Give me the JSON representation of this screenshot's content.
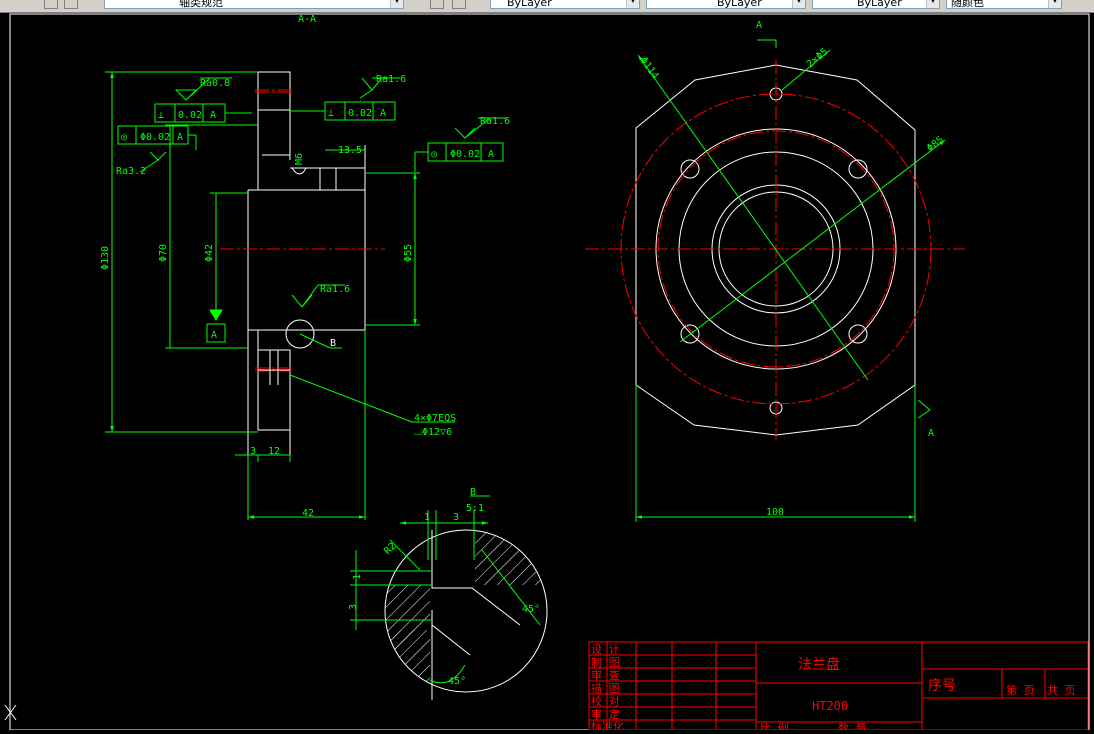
{
  "toolbar": {
    "layer_name": "轴类规范",
    "color_control": "ByLayer",
    "linetype_control": "ByLayer",
    "lineweight_control": "ByLayer",
    "plotstyle_control": "随颜色"
  },
  "drawing": {
    "section_title": "A-A",
    "view_marker_a": "A",
    "detail_marker": "B",
    "detail_scale": "5:1",
    "roughness": [
      "Ra0.8",
      "Ra1.6",
      "Ra1.6",
      "Ra3.2",
      "Ra1.6"
    ],
    "tolerance": {
      "perp_value": "0.02",
      "perp_datum": "A",
      "perp2_value": "0.02",
      "perp2_datum": "A",
      "conc_value": "Φ0.02",
      "conc_datum": "A",
      "conc2_value": "Φ0.02",
      "conc2_datum": "A"
    },
    "dims": {
      "d130": "Φ130",
      "d70": "Φ70",
      "d42": "Φ42",
      "d55": "Φ55",
      "w13_5": "13.5",
      "m6": "M6",
      "w3": "3",
      "w12": "12",
      "w42": "42",
      "holes1": "4×Φ7EQS",
      "holes2": "⌴Φ12▽6",
      "datum_a": "A",
      "leader_b": "B",
      "d114": "Φ114",
      "d2x25": "2×Φ5",
      "d85": "Φ85",
      "w100": "100",
      "det_1": "1",
      "det_3": "3",
      "det_v1": "1",
      "det_v3": "3",
      "det_r": "R2",
      "det_45a": "45°",
      "det_45b": "45°"
    }
  },
  "title_block": {
    "part_name": "法兰盘",
    "material": "HT200",
    "serial_label": "序号",
    "page_label": "第  页",
    "total_label": "共  页",
    "rows": [
      "设  计",
      "制  图",
      "审  查",
      "描  图",
      "校  对",
      "审  定",
      "标准化"
    ],
    "bottom_labels": [
      "比  例",
      "数  量"
    ]
  },
  "colors": {
    "background": "#000000",
    "outline": "#ffffff",
    "dimension": "#00ff00",
    "center": "#ff0000",
    "hatch": "#ffffff",
    "title_block": "#ff0000"
  }
}
